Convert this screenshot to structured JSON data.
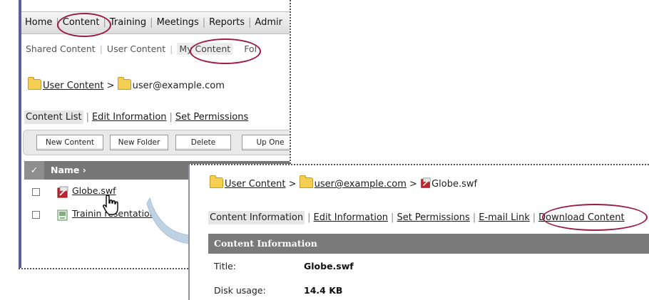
{
  "top_nav": {
    "items": [
      "Home",
      "Content",
      "Training",
      "Meetings",
      "Reports",
      "Admir"
    ]
  },
  "sub_nav": {
    "items": [
      "Shared Content",
      "User Content",
      "My Content",
      "Fol"
    ]
  },
  "panel1": {
    "breadcrumb": {
      "root": "User Content",
      "sep": ">",
      "current": "user@example.com"
    },
    "tabs": {
      "content_list": "Content List",
      "edit_information": "Edit Information",
      "set_permissions": "Set Permissions",
      "sep": "|"
    },
    "toolbar": {
      "new_content": "New Content",
      "new_folder": "New Folder",
      "delete": "Delete",
      "up_one": "Up One"
    },
    "list": {
      "header_check": "✓",
      "header_name": "Name ›",
      "rows": [
        {
          "name": "Globe.swf",
          "type": "swf"
        },
        {
          "name": "Trainin  resentation",
          "type": "presentation"
        }
      ]
    }
  },
  "panel2": {
    "breadcrumb": {
      "root": "User Content",
      "sep": ">",
      "folder": "user@example.com",
      "file": "Globe.swf"
    },
    "tabs": {
      "content_information": "Content Information",
      "edit_information": "Edit Information",
      "set_permissions": "Set Permissions",
      "email_link": "E-mail Link",
      "download_content": "Download Content",
      "sep": "|"
    },
    "section_header": "Content Information",
    "fields": [
      {
        "label": "Title:",
        "value": "Globe.swf"
      },
      {
        "label": "Disk usage:",
        "value": "14.4 KB"
      }
    ]
  },
  "colors": {
    "callout": "#9b1b45",
    "header_gray": "#777777",
    "arrow": "#b8cde0",
    "folder": "#f5cf52"
  }
}
